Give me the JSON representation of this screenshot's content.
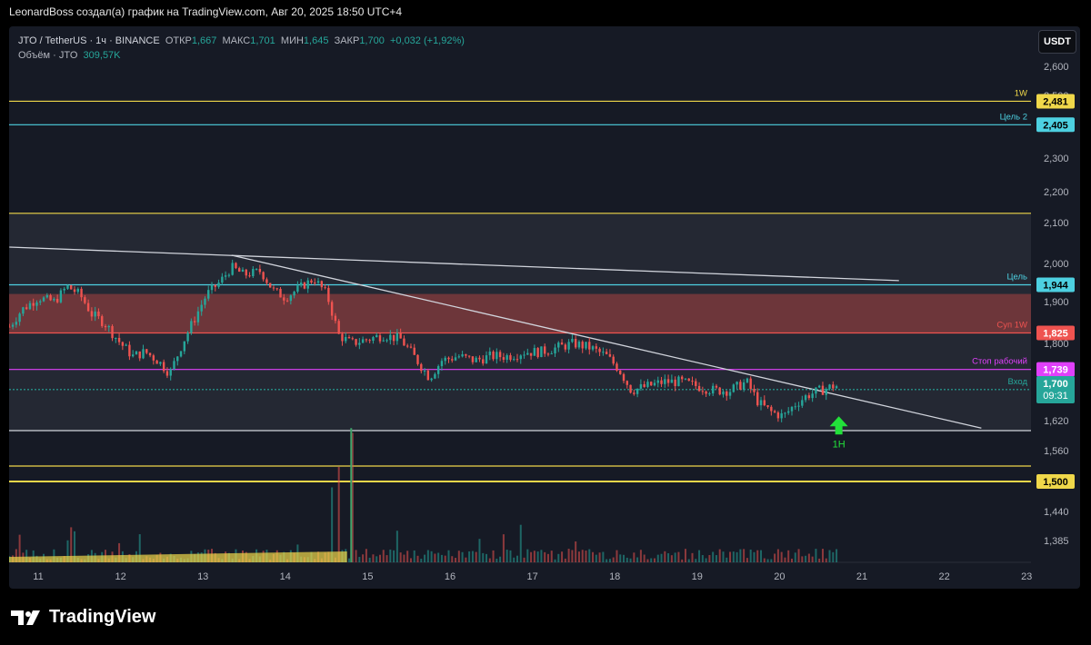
{
  "header": {
    "text": "LeonardBoss создал(а) график на TradingView.com, Авг 20, 2025 18:50 UTC+4"
  },
  "legend": {
    "symbol": "JTO / TetherUS · 1ч · BINANCE",
    "open_label": "ОТКР",
    "open": "1,667",
    "high_label": "МАКС",
    "high": "1,701",
    "low_label": "МИН",
    "low": "1,645",
    "close_label": "ЗАКР",
    "close": "1,700",
    "change": "+0,032 (+1,92%)",
    "volume_label": "Объём · JTO",
    "volume": "309,57K"
  },
  "currency": "USDT",
  "logo": {
    "text": "TradingView"
  },
  "colors": {
    "up": "#26a69a",
    "down": "#ef5350",
    "yellow": "#f0d84a",
    "cyan": "#4dd0e1",
    "magenta": "#e040fb",
    "white": "#d1d4dc",
    "green_arrow": "#22e03a"
  },
  "chart_data": {
    "type": "candlestick",
    "title": "",
    "x_ticks": [
      "11",
      "12",
      "13",
      "14",
      "15",
      "16",
      "17",
      "18",
      "19",
      "20",
      "21",
      "22",
      "23"
    ],
    "x_range_days": [
      10.65,
      23.2
    ],
    "y_ticks": [
      "2,600",
      "2,500",
      "2,400",
      "2,300",
      "2,200",
      "2,100",
      "2,000",
      "1,900",
      "1,800",
      "1,700",
      "1,620",
      "1,560",
      "1,500",
      "1,440",
      "1,385"
    ],
    "y_axis": "right, irregular scale",
    "levels": [
      {
        "price": 2.481,
        "label": "2,481",
        "tag": "1W",
        "color": "yellow"
      },
      {
        "price": 2.405,
        "label": "2,405",
        "tag": "Цель 2",
        "color": "cyan"
      },
      {
        "price": 2.13,
        "color": "yellow"
      },
      {
        "price": 1.944,
        "label": "1,944",
        "tag": "Цель",
        "color": "cyan"
      },
      {
        "price": 1.825,
        "label": "1,825",
        "tag": "Суп 1W",
        "color": "red"
      },
      {
        "price": 1.739,
        "label": "1,739",
        "tag": "Стоп рабочий",
        "color": "magenta"
      },
      {
        "price": 1.692,
        "label": "1,692",
        "tag": "Вход",
        "color": "green"
      },
      {
        "price": 1.6,
        "color": "white"
      },
      {
        "price": 1.53,
        "color": "yellow"
      },
      {
        "price": 1.5,
        "label": "1,500",
        "color": "yellow"
      }
    ],
    "zones": [
      {
        "from": 1.825,
        "to": 1.92,
        "color": "red"
      },
      {
        "from": 1.6,
        "to": 2.13,
        "color": "grey"
      }
    ],
    "last_price": {
      "label": "1,700",
      "countdown": "09:31"
    },
    "arrow": {
      "label": "1H",
      "day": 20.72
    },
    "trendlines": [
      {
        "from": [
          10.65,
          2.04
        ],
        "to": [
          21.45,
          1.955
        ]
      },
      {
        "from": [
          13.35,
          2.02
        ],
        "to": [
          22.45,
          1.605
        ]
      }
    ],
    "path": [
      [
        10.65,
        1.84
      ],
      [
        10.8,
        1.88
      ],
      [
        11.0,
        1.91
      ],
      [
        11.2,
        1.9
      ],
      [
        11.35,
        1.94
      ],
      [
        11.5,
        1.92
      ],
      [
        11.65,
        1.87
      ],
      [
        11.8,
        1.85
      ],
      [
        12.0,
        1.8
      ],
      [
        12.15,
        1.77
      ],
      [
        12.3,
        1.78
      ],
      [
        12.45,
        1.76
      ],
      [
        12.6,
        1.73
      ],
      [
        12.75,
        1.8
      ],
      [
        12.9,
        1.86
      ],
      [
        13.05,
        1.92
      ],
      [
        13.2,
        1.95
      ],
      [
        13.35,
        1.99
      ],
      [
        13.5,
        1.97
      ],
      [
        13.7,
        1.98
      ],
      [
        13.85,
        1.93
      ],
      [
        14.0,
        1.91
      ],
      [
        14.2,
        1.94
      ],
      [
        14.35,
        1.96
      ],
      [
        14.5,
        1.92
      ],
      [
        14.65,
        1.82
      ],
      [
        14.8,
        1.8
      ],
      [
        15.0,
        1.81
      ],
      [
        15.2,
        1.82
      ],
      [
        15.4,
        1.81
      ],
      [
        15.6,
        1.76
      ],
      [
        15.75,
        1.72
      ],
      [
        15.9,
        1.76
      ],
      [
        16.1,
        1.77
      ],
      [
        16.3,
        1.76
      ],
      [
        16.5,
        1.77
      ],
      [
        16.7,
        1.77
      ],
      [
        16.9,
        1.78
      ],
      [
        17.1,
        1.78
      ],
      [
        17.3,
        1.79
      ],
      [
        17.5,
        1.8
      ],
      [
        17.7,
        1.79
      ],
      [
        17.9,
        1.77
      ],
      [
        18.05,
        1.74
      ],
      [
        18.2,
        1.69
      ],
      [
        18.4,
        1.7
      ],
      [
        18.6,
        1.71
      ],
      [
        18.8,
        1.71
      ],
      [
        19.0,
        1.7
      ],
      [
        19.2,
        1.69
      ],
      [
        19.4,
        1.69
      ],
      [
        19.6,
        1.71
      ],
      [
        19.75,
        1.66
      ],
      [
        19.9,
        1.64
      ],
      [
        20.05,
        1.63
      ],
      [
        20.2,
        1.66
      ],
      [
        20.35,
        1.68
      ],
      [
        20.5,
        1.69
      ],
      [
        20.65,
        1.7
      ],
      [
        20.73,
        1.7
      ]
    ],
    "volume_spikes": [
      {
        "day": 14.8,
        "height": 0.95
      },
      {
        "day": 14.65,
        "height": 0.7
      },
      {
        "day": 14.55,
        "height": 0.55
      }
    ]
  }
}
